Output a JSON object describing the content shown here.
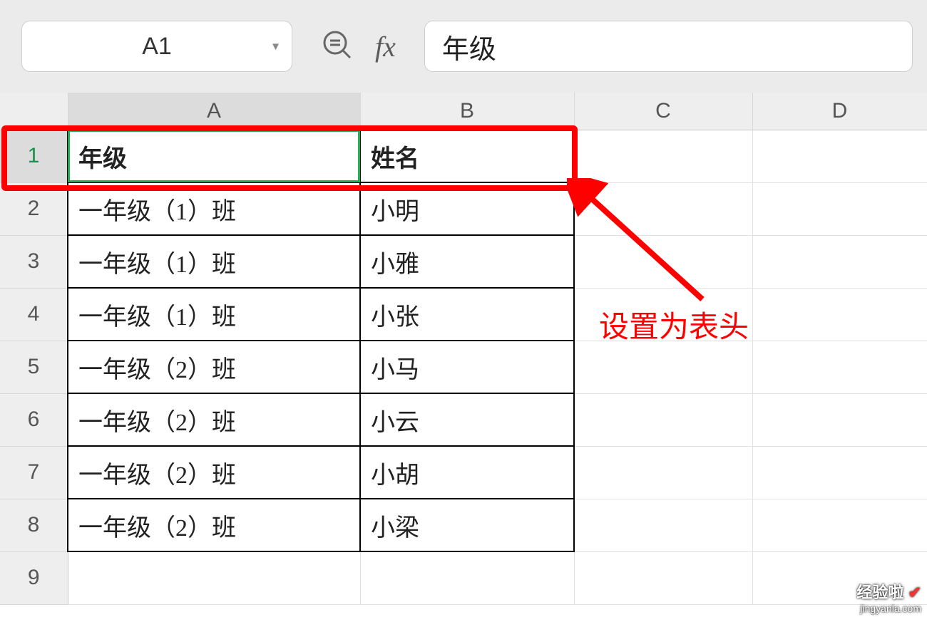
{
  "namebox": {
    "value": "A1"
  },
  "formula": {
    "value": "年级"
  },
  "icons": {
    "fx": "fx"
  },
  "columns": {
    "a": "A",
    "b": "B",
    "c": "C",
    "d": "D"
  },
  "rownums": {
    "r1": "1",
    "r2": "2",
    "r3": "3",
    "r4": "4",
    "r5": "5",
    "r6": "6",
    "r7": "7",
    "r8": "8",
    "r9": "9"
  },
  "cells": {
    "a1": "年级",
    "b1": "姓名",
    "a2": "一年级（1）班",
    "b2": "小明",
    "a3": "一年级（1）班",
    "b3": "小雅",
    "a4": "一年级（1）班",
    "b4": "小张",
    "a5": "一年级（2）班",
    "b5": "小马",
    "a6": "一年级（2）班",
    "b6": "小云",
    "a7": "一年级（2）班",
    "b7": "小胡",
    "a8": "一年级（2）班",
    "b8": "小梁"
  },
  "annotation": {
    "label": "设置为表头"
  },
  "watermark": {
    "line1": "经验啦",
    "check": "✔",
    "line2": "jingyanla.com"
  }
}
